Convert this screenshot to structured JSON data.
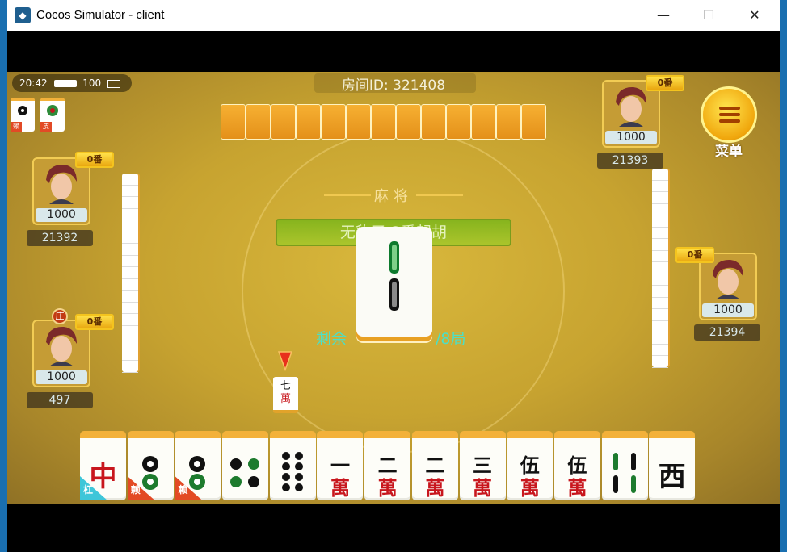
{
  "window": {
    "title": "Cocos Simulator - client",
    "minimize_glyph": "—",
    "maximize_glyph": "☐",
    "close_glyph": "✕"
  },
  "status": {
    "time": "20:42",
    "battery": "100"
  },
  "room": {
    "label": "房间ID: 321408"
  },
  "menu": {
    "label": "菜单"
  },
  "center": {
    "title": "麻将",
    "rule_text": "无豹子  2番起胡",
    "remain_prefix": "剩余",
    "round_suffix": "/8局"
  },
  "players": {
    "top_right": {
      "chips": "1000",
      "score": "21393",
      "fan": "0番"
    },
    "left_top": {
      "chips": "1000",
      "score": "21392",
      "fan": "0番"
    },
    "left_bottom": {
      "chips": "1000",
      "score": "497",
      "fan": "0番",
      "dealer": "庄"
    },
    "right": {
      "chips": "1000",
      "score": "21394",
      "fan": "0番"
    }
  },
  "corner_tiles": [
    {
      "tag": "赖"
    },
    {
      "tag": "皮"
    }
  ],
  "discard": {
    "num": "七",
    "suit": "萬"
  },
  "hand": [
    {
      "kind": "zhong",
      "char": "中",
      "tag": "杠",
      "tag_color": "#3ec6d9"
    },
    {
      "kind": "tong",
      "tag": "赖",
      "tag_color": "#e34a25"
    },
    {
      "kind": "tong",
      "tag": "赖",
      "tag_color": "#e34a25"
    },
    {
      "kind": "tong4"
    },
    {
      "kind": "tong8"
    },
    {
      "kind": "wan",
      "num": "一",
      "suit": "萬"
    },
    {
      "kind": "wan",
      "num": "二",
      "suit": "萬"
    },
    {
      "kind": "wan",
      "num": "二",
      "suit": "萬"
    },
    {
      "kind": "wan",
      "num": "三",
      "suit": "萬"
    },
    {
      "kind": "wan",
      "num": "伍",
      "suit": "萬"
    },
    {
      "kind": "wan",
      "num": "伍",
      "suit": "萬"
    },
    {
      "kind": "tiao"
    },
    {
      "kind": "feng",
      "char": "西"
    }
  ]
}
